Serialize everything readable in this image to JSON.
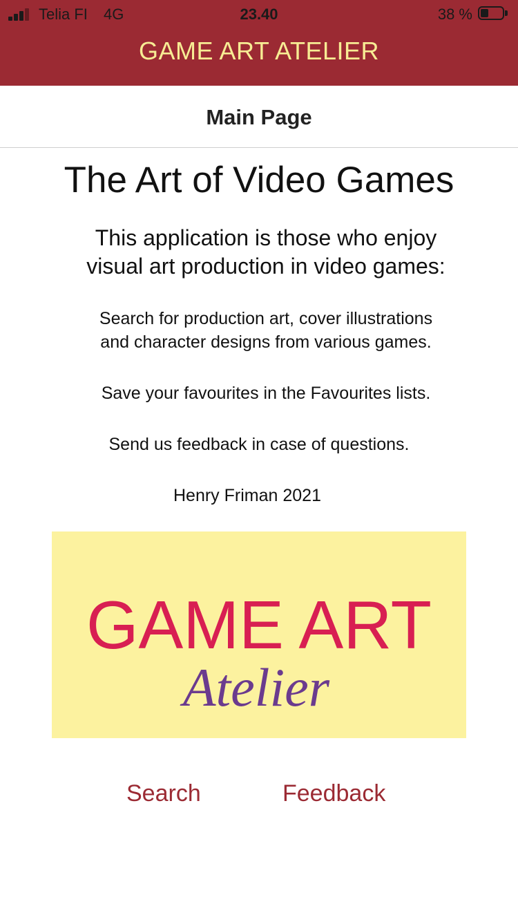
{
  "status_bar": {
    "carrier": "Telia FI",
    "network": "4G",
    "time": "23.40",
    "battery_percent": "38 %",
    "battery_level": 0.38,
    "text_color": "#1a1a1a"
  },
  "header": {
    "title": "GAME ART ATELIER",
    "background_color": "#9b2a33",
    "title_color": "#f7ec94"
  },
  "nav": {
    "title": "Main Page"
  },
  "main": {
    "headline": "The Art of Video Games",
    "intro_lines": [
      "This application is those who enjoy",
      "visual art production in video games:"
    ],
    "search_lines": [
      "Search for production art, cover illustrations",
      "and character designs from various games."
    ],
    "favourites_text": "Save your favourites in the Favourites lists.",
    "feedback_text": "Send us feedback in case of questions.",
    "credit": "Henry Friman 2021"
  },
  "logo": {
    "line1": "GAME ART",
    "line2": "Atelier",
    "background_color": "#fcf29f",
    "line1_color": "#d81f52",
    "line2_color": "#6b3b8e"
  },
  "bottom_links": {
    "search_label": "Search",
    "feedback_label": "Feedback",
    "link_color": "#9b2a33"
  }
}
